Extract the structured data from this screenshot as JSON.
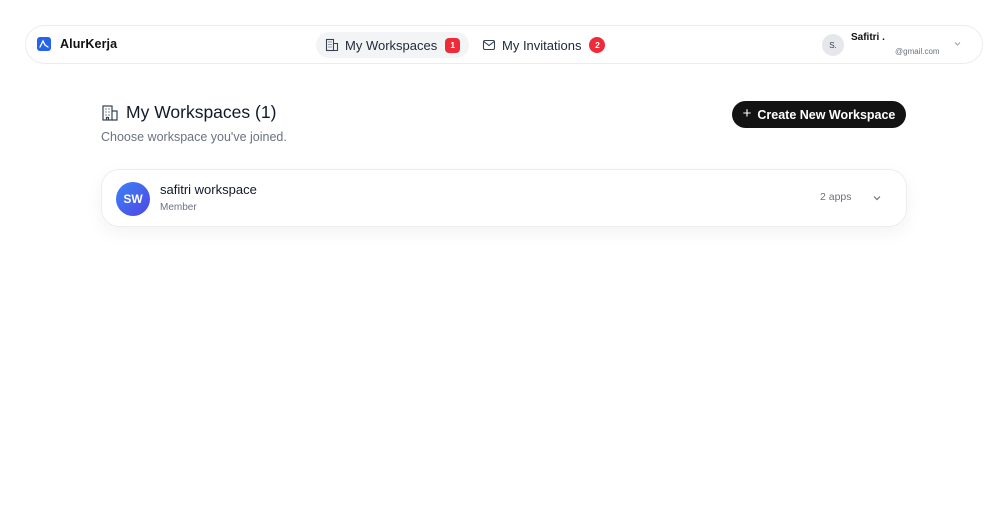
{
  "brand": {
    "name": "AlurKerja",
    "logo_icon": "wave-icon",
    "logo_color": "#2563eb"
  },
  "nav": {
    "workspaces": {
      "label": "My Workspaces",
      "count": "1",
      "icon": "building-icon"
    },
    "invitations": {
      "label": "My Invitations",
      "count": "2",
      "icon": "mail-icon"
    }
  },
  "user": {
    "initials": "S.",
    "name": "Safitri .",
    "email": "@gmail.com"
  },
  "header": {
    "title": "My Workspaces (1)",
    "subtitle": "Choose workspace you've joined.",
    "create_button": "Create New Workspace"
  },
  "workspaces": [
    {
      "initials": "SW",
      "name": "safitri workspace",
      "role": "Member",
      "apps": "2 apps"
    }
  ],
  "colors": {
    "badge": "#ef2b39",
    "primary_button": "#131313",
    "avatar_gradient": [
      "#3b82f6",
      "#4f46e5"
    ]
  }
}
